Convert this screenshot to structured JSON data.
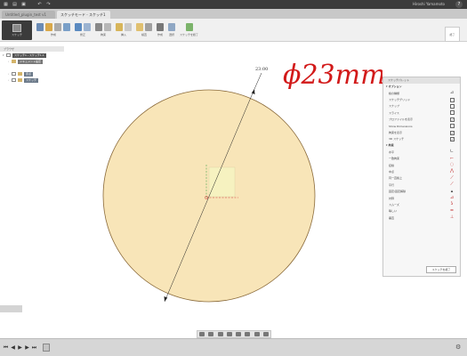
{
  "titlebar": {
    "user_name": "Hiroshi Yamamoto",
    "help_icon": "help-icon"
  },
  "tabs": [
    {
      "label": "Untitled_plugin_test v1"
    },
    {
      "label": "スケッチモード - スケッチ1"
    }
  ],
  "toolbar": {
    "workspace_label": "スケッチ",
    "groups": [
      {
        "label": "作成",
        "icons": 4
      },
      {
        "label": "修正",
        "icons": 2
      },
      {
        "label": "拘束",
        "icons": 2
      },
      {
        "label": "挿入",
        "icons": 2
      },
      {
        "label": "検査",
        "icons": 2
      },
      {
        "label": "作成",
        "icons": 1
      },
      {
        "label": "選択",
        "icons": 1
      },
      {
        "label": "スケッチを終了",
        "icons": 1
      }
    ],
    "panel_button": "終了"
  },
  "browser": {
    "header": "ブラウザ",
    "items": [
      {
        "label": "スケッチ1 - スケッチ1.1",
        "level": 0
      },
      {
        "label": "ドキュメント設定",
        "level": 1
      },
      {
        "label": "原点",
        "level": 1
      },
      {
        "label": "スケッチ",
        "level": 1
      }
    ]
  },
  "canvas": {
    "dimension_label": "23.00",
    "annotation_text": "ϕ23mm",
    "circle_fill": "#f8e5b8",
    "annotation_color": "#d21a1a"
  },
  "palette": {
    "header": "スケッチパレット",
    "options_label": "オプション",
    "options": [
      {
        "label": "線の種類",
        "checked": false,
        "icon": "linetype-icon"
      },
      {
        "label": "スケッチグリッド",
        "checked": false
      },
      {
        "label": "スナップ",
        "checked": false
      },
      {
        "label": "スライス",
        "checked": false
      },
      {
        "label": "プロファイルを表示",
        "checked": true
      },
      {
        "label": "Show Dimensions",
        "checked": false
      },
      {
        "label": "拘束を表示",
        "checked": true
      },
      {
        "label": "3D スケッチ",
        "checked": true
      }
    ],
    "constraints_label": "拘束",
    "constraints": [
      {
        "label": "水平",
        "icon": "horizontal-icon"
      },
      {
        "label": "一致拘束",
        "icon": "coincident-icon"
      },
      {
        "label": "接線",
        "icon": "tangent-icon"
      },
      {
        "label": "中点",
        "icon": "midpoint-icon"
      },
      {
        "label": "同一直線上",
        "icon": "collinear-icon"
      },
      {
        "label": "平行",
        "icon": "parallel-icon"
      },
      {
        "label": "固定/固定解除",
        "icon": "fix-icon"
      },
      {
        "label": "対称",
        "icon": "symmetry-icon"
      },
      {
        "label": "スムーズ",
        "icon": "smooth-icon"
      },
      {
        "label": "等しい",
        "icon": "equal-icon"
      },
      {
        "label": "垂直",
        "icon": "perpendicular-icon"
      }
    ],
    "finish_button": "スケッチを終了"
  },
  "timeline": {
    "feature_icon": "sketch-feature-icon"
  }
}
